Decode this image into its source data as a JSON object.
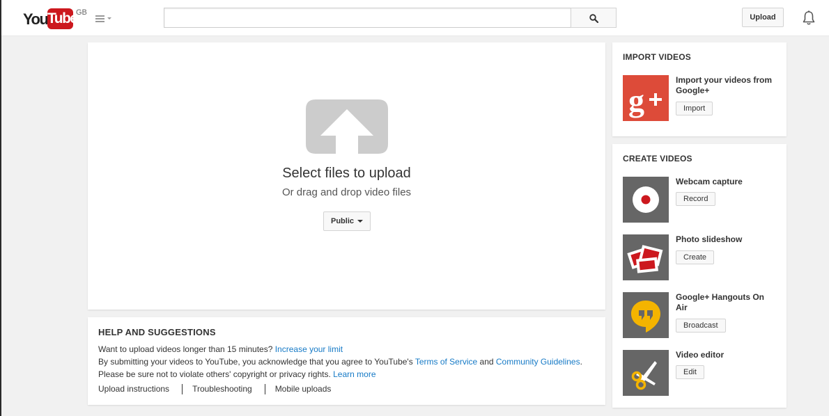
{
  "masthead": {
    "logo_you": "You",
    "logo_tube": "Tube",
    "country_code": "GB",
    "search_placeholder": "",
    "upload_label": "Upload"
  },
  "upload": {
    "title": "Select files to upload",
    "subtitle": "Or drag and drop video files",
    "privacy_label": "Public"
  },
  "help": {
    "title": "HELP AND SUGGESTIONS",
    "line1_text": "Want to upload videos longer than 15 minutes? ",
    "line1_link": "Increase your limit",
    "line2_text1": "By submitting your videos to YouTube, you acknowledge that you agree to YouTube's ",
    "line2_link1": "Terms of Service",
    "line2_text2": " and ",
    "line2_link2": "Community Guidelines",
    "line2_text3": ".",
    "line3_text": "Please be sure not to violate others' copyright or privacy rights. ",
    "line3_link": "Learn more",
    "links": [
      "Upload instructions",
      "Troubleshooting",
      "Mobile uploads"
    ]
  },
  "import_videos": {
    "title": "IMPORT VIDEOS",
    "items": [
      {
        "label": "Import your videos from Google+",
        "button": "Import",
        "icon": "google-plus-icon",
        "tile_color": "#dd4b39"
      }
    ]
  },
  "create_videos": {
    "title": "CREATE VIDEOS",
    "items": [
      {
        "label": "Webcam capture",
        "button": "Record",
        "icon": "webcam-record-icon",
        "tile_color": "#666666"
      },
      {
        "label": "Photo slideshow",
        "button": "Create",
        "icon": "photo-slideshow-icon",
        "tile_color": "#666666"
      },
      {
        "label": "Google+ Hangouts On Air",
        "button": "Broadcast",
        "icon": "hangouts-icon",
        "tile_color": "#666666"
      },
      {
        "label": "Video editor",
        "button": "Edit",
        "icon": "scissors-icon",
        "tile_color": "#666666"
      }
    ]
  },
  "colors": {
    "brand_red": "#cc181e",
    "link_blue": "#167ac6",
    "hangouts_yellow": "#f4b400",
    "google_plus_red": "#dd4b39"
  }
}
